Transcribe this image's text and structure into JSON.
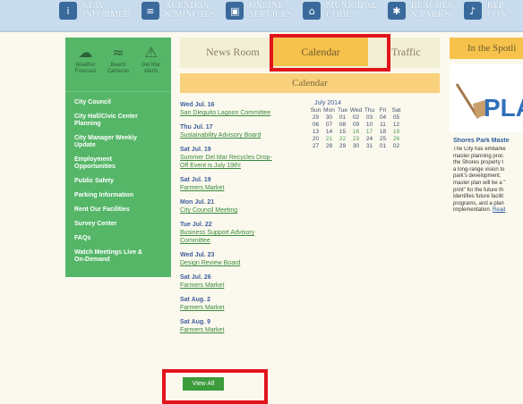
{
  "top_nav": [
    {
      "label": "STAY\nINFORMED",
      "icon": "info-icon"
    },
    {
      "label": "AGENDAS\n& MINUTES",
      "icon": "agenda-icon"
    },
    {
      "label": "ONLINE\nSERVICES",
      "icon": "online-icon"
    },
    {
      "label": "MUNICIPAL\nCODE",
      "icon": "building-icon"
    },
    {
      "label": "BEACHES\n& PARKS",
      "icon": "palm-icon"
    },
    {
      "label": "REP\nCON",
      "icon": "mic-icon"
    }
  ],
  "sidebar": {
    "icons": [
      {
        "label": "Weather\nForecast",
        "icon": "cloud-icon"
      },
      {
        "label": "Beach\nCameras",
        "icon": "swimmer-icon"
      },
      {
        "label": "Del Mar\nAlerts",
        "icon": "alert-icon"
      }
    ],
    "links": [
      "City Council",
      "City Hall/Civic Center\nPlanning",
      "City Manager Weekly\nUpdate",
      "Employment\nOpportunities",
      "Public Safety",
      "Parking Information",
      "Rent Our Facilities",
      "Survey Center",
      "FAQs",
      "Watch Meetings Live &\nOn-Demand"
    ]
  },
  "tabs": {
    "news": "News Room",
    "calendar": "Calendar",
    "traffic": "Traffic"
  },
  "calendar_header": "Calendar",
  "events": [
    {
      "date": "Wed Jul. 16",
      "name": "San Dieguito Lagoon Committee"
    },
    {
      "date": "Thu Jul. 17",
      "name": "Sustainability Advisory Board"
    },
    {
      "date": "Sat Jul. 19",
      "name": "Summer Del Mar Recycles Drop-\nOff Event is July 19th!"
    },
    {
      "date": "Sat Jul. 19",
      "name": "Farmers Market"
    },
    {
      "date": "Mon Jul. 21",
      "name": "City Council Meeting"
    },
    {
      "date": "Tue Jul. 22",
      "name": "Business Support Advisory\nCommittee"
    },
    {
      "date": "Wed Jul. 23",
      "name": "Design Review Board"
    },
    {
      "date": "Sat Jul. 26",
      "name": "Farmers Market"
    },
    {
      "date": "Sat Aug. 2",
      "name": "Farmers Market"
    },
    {
      "date": "Sat Aug. 9",
      "name": "Farmers Market"
    }
  ],
  "mini_calendar": {
    "title": "July 2014",
    "days": [
      "Sun",
      "Mon",
      "Tue",
      "Wed",
      "Thu",
      "Fri",
      "Sat"
    ],
    "weeks": [
      [
        "29",
        "30",
        "01",
        "02",
        "03",
        "04",
        "05"
      ],
      [
        "06",
        "07",
        "08",
        "09",
        "10",
        "11",
        "12"
      ],
      [
        "13",
        "14",
        "15",
        "16",
        "17",
        "18",
        "19"
      ],
      [
        "20",
        "21",
        "22",
        "23",
        "24",
        "25",
        "26"
      ],
      [
        "27",
        "28",
        "29",
        "30",
        "31",
        "01",
        "02"
      ]
    ]
  },
  "view_all": "View All",
  "spotlight": {
    "header": "In the Spotli",
    "image_text": "PLA",
    "title": "Shores Park Maste",
    "text": "The City has embarke\nmaster planning proc\nthe Shores property t\na long-range vision to\npark's development.\nmaster plan will be a \"\nprint\" for the future th\nidentifies future facilit\nprograms, and a plan \nimplementation.",
    "read_more": "Read"
  },
  "colors": {
    "highlight": "#e1141c",
    "sidebar": "#55b668",
    "accent": "#f6c24c"
  }
}
